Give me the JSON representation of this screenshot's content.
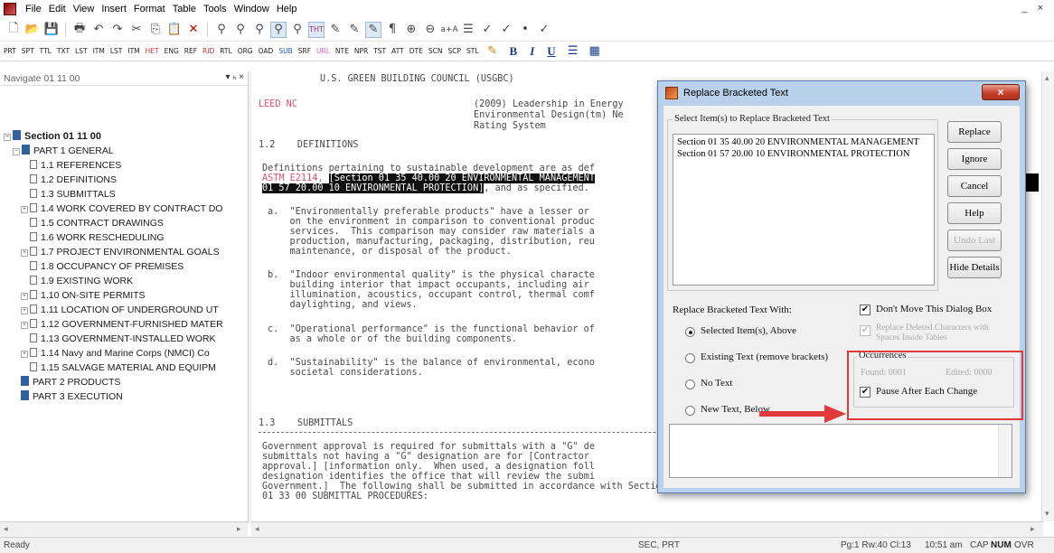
{
  "menubar": {
    "items": [
      "File",
      "Edit",
      "View",
      "Insert",
      "Format",
      "Table",
      "Tools",
      "Window",
      "Help"
    ],
    "window_controls": "_ ×"
  },
  "toolbar2": {
    "tags": [
      "PRT",
      "SPT",
      "TTL",
      "TXT",
      "LST",
      "ITM",
      "LST",
      "ITM",
      "HET",
      "ENG",
      "REF",
      "RID",
      "RTL",
      "ORG",
      "OAD",
      "SUB",
      "SRF",
      "URL",
      "NTE",
      "NPR",
      "TST",
      "ATT",
      "DTE",
      "SCN",
      "SCP",
      "STL"
    ],
    "format": [
      "B",
      "I",
      "U"
    ]
  },
  "navigator": {
    "title": "Navigate 01 11 00",
    "pins": "▾ ₕ ×",
    "items": [
      {
        "label": "Section 01 11 00",
        "level": 0
      },
      {
        "label": "PART 1  GENERAL",
        "level": 1
      },
      {
        "label": "1.1  REFERENCES",
        "level": 2
      },
      {
        "label": "1.2  DEFINITIONS",
        "level": 2
      },
      {
        "label": "1.3  SUBMITTALS",
        "level": 2
      },
      {
        "label": "1.4  WORK COVERED BY CONTRACT DO",
        "level": 2
      },
      {
        "label": "1.5  CONTRACT DRAWINGS",
        "level": 2
      },
      {
        "label": "1.6  WORK RESCHEDULING",
        "level": 2
      },
      {
        "label": "1.7  PROJECT ENVIRONMENTAL GOALS",
        "level": 2
      },
      {
        "label": "1.8  OCCUPANCY OF PREMISES",
        "level": 2
      },
      {
        "label": "1.9  EXISTING WORK",
        "level": 2
      },
      {
        "label": "1.10  ON-SITE PERMITS",
        "level": 2
      },
      {
        "label": "1.11  LOCATION OF UNDERGROUND UT",
        "level": 2
      },
      {
        "label": "1.12  GOVERNMENT-FURNISHED MATER",
        "level": 2
      },
      {
        "label": "1.13  GOVERNMENT-INSTALLED WORK",
        "level": 2
      },
      {
        "label": "1.14  Navy and Marine Corps (NMCI) Co",
        "level": 2
      },
      {
        "label": "1.15  SALVAGE MATERIAL AND EQUIPM",
        "level": 2
      },
      {
        "label": "PART 2  PRODUCTS",
        "level": 1
      },
      {
        "label": "PART 3  EXECUTION",
        "level": 1
      }
    ]
  },
  "document": {
    "l1": "U.S. GREEN BUILDING COUNCIL (USGBC)",
    "l2a": "LEED NC",
    "l2b": "(2009) Leadership in Energy",
    "l3": "Environmental Design(tm) Ne",
    "l4": "Rating System",
    "h12": "1.2    DEFINITIONS",
    "d1": "Definitions pertaining to sustainable development are as def",
    "d2a": "ASTM E2114,",
    "d2b": "[Section 01 35 40.00 20 ENVIRONMENTAL MANAGEMENT",
    "d3a": "01 57 20.00 10 ENVIRONMENTAL PROTECTION]",
    "d3b": ", and as specified.",
    "a1": "a.  \"Environmentally preferable products\" have a lesser or",
    "a2": "    on the environment in comparison to conventional produc",
    "a3": "    services.  This comparison may consider raw materials a",
    "a4": "    production, manufacturing, packaging, distribution, reu",
    "a5": "    maintenance, or disposal of the product.",
    "b1": "b.  \"Indoor environmental quality\" is the physical characte",
    "b2": "    building interior that impact occupants, including air",
    "b3": "    illumination, acoustics, occupant control, thermal comf",
    "b4": "    daylighting, and views.",
    "c1": "c.  \"Operational performance\" is the functional behavior of",
    "c2": "    as a whole or of the building components.",
    "e1": "d.  \"Sustainability\" is the balance of environmental, econo",
    "e2": "    societal considerations.",
    "h13": "1.3    SUBMITTALS",
    "s1": "Government approval is required for submittals with a \"G\" de",
    "s2": "submittals not having a \"G\" designation are for [Contractor",
    "s3": "approval.] [information only.  When used, a designation foll",
    "s4": "designation identifies the office that will review the submi",
    "s5": "Government.]  The following shall be submitted in accordance with Section",
    "s6": "01 33 00 SUBMITTAL PROCEDURES:"
  },
  "dialog": {
    "title": "Replace Bracketed Text",
    "close": "×",
    "select_label": "Select Item(s) to Replace Bracketed Text",
    "items": [
      "Section 01 35 40.00 20 ENVIRONMENTAL MANAGEMENT",
      "Section 01 57 20.00 10 ENVIRONMENTAL PROTECTION"
    ],
    "buttons": {
      "replace": "Replace",
      "ignore": "Ignore",
      "cancel": "Cancel",
      "help": "Help",
      "undo_last": "Undo Last",
      "hide_details": "Hide Details"
    },
    "replace_with_label": "Replace Bracketed Text With:",
    "options": {
      "selected": "Selected Item(s), Above",
      "existing": "Existing Text (remove brackets)",
      "no_text": "No Text",
      "new_text": "New Text, Below"
    },
    "dont_move": "Don't Move This Dialog Box",
    "replace_deleted": "Replace Deleted Characters with Spaces Inside Tables",
    "occurrences_label": "Occurrences",
    "found": "Found: 0001",
    "edited": "Edited: 0000",
    "pause": "Pause After Each Change",
    "check": "✔"
  },
  "status": {
    "ready": "Ready",
    "sec": "SEC, PRT",
    "pos": "Pg:1 Rw:40 Cl:13",
    "time": "10:51 am",
    "cap": "CAP",
    "num": "NUM",
    "ovr": "OVR"
  },
  "colors": {
    "highlight_box": "#e03a3a",
    "dialog_frame": "#b9d1ea",
    "tag_red": "#e05070"
  }
}
